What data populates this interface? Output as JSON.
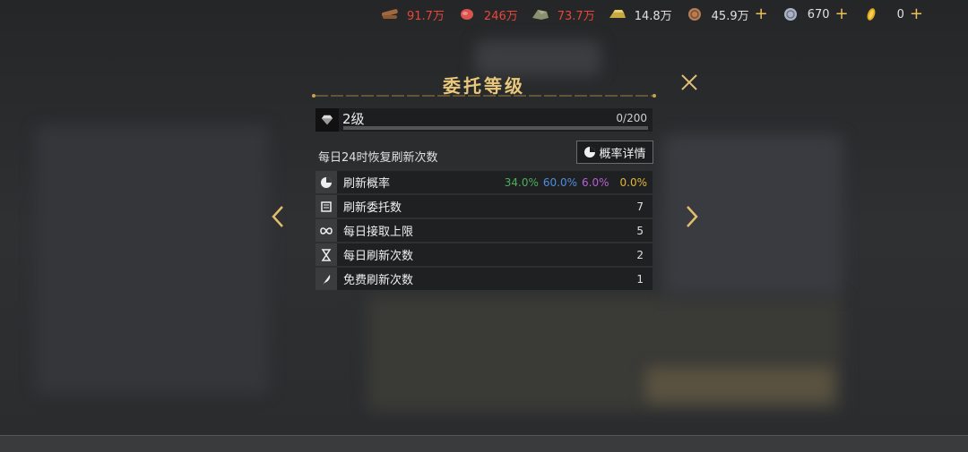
{
  "resources": [
    {
      "icon": "wood-icon",
      "value": "91.7万",
      "red": true,
      "plus": false
    },
    {
      "icon": "meat-icon",
      "value": "246万",
      "red": true,
      "plus": false
    },
    {
      "icon": "stone-icon",
      "value": "73.7万",
      "red": true,
      "plus": false
    },
    {
      "icon": "gold-bar-icon",
      "value": "14.8万",
      "red": false,
      "plus": false
    },
    {
      "icon": "copper-coin-icon",
      "value": "45.9万",
      "red": false,
      "plus": true
    },
    {
      "icon": "silver-coin-icon",
      "value": "670",
      "red": false,
      "plus": true
    },
    {
      "icon": "gold-token-icon",
      "value": "0",
      "red": false,
      "plus": true
    }
  ],
  "plus_label": "+",
  "dialog": {
    "title": "委托等级",
    "level": {
      "label": "2级",
      "progress_text": "0/200",
      "progress": 0
    },
    "subtitle": "每日24时恢复刷新次数",
    "prob_button": "概率详情",
    "rows": [
      {
        "icon": "probability-icon",
        "label": "刷新概率",
        "rates": [
          {
            "text": "34.0%",
            "color": "#4fae5c"
          },
          {
            "text": "60.0%",
            "color": "#4f8de0"
          },
          {
            "text": "6.0%",
            "color": "#b75fd6"
          },
          {
            "text": "0.0%",
            "color": "#e2b53a"
          }
        ]
      },
      {
        "icon": "scroll-icon",
        "label": "刷新委托数",
        "value": "7"
      },
      {
        "icon": "infinity-icon",
        "label": "每日接取上限",
        "value": "5"
      },
      {
        "icon": "hourglass-icon",
        "label": "每日刷新次数",
        "value": "2"
      },
      {
        "icon": "feather-icon",
        "label": "免费刷新次数",
        "value": "1"
      }
    ]
  },
  "colors": {
    "accent": "#e9c87b",
    "rate_green": "#4fae5c",
    "rate_blue": "#4f8de0",
    "rate_purple": "#b75fd6",
    "rate_gold": "#e2b53a",
    "red_value": "#e5473a"
  }
}
